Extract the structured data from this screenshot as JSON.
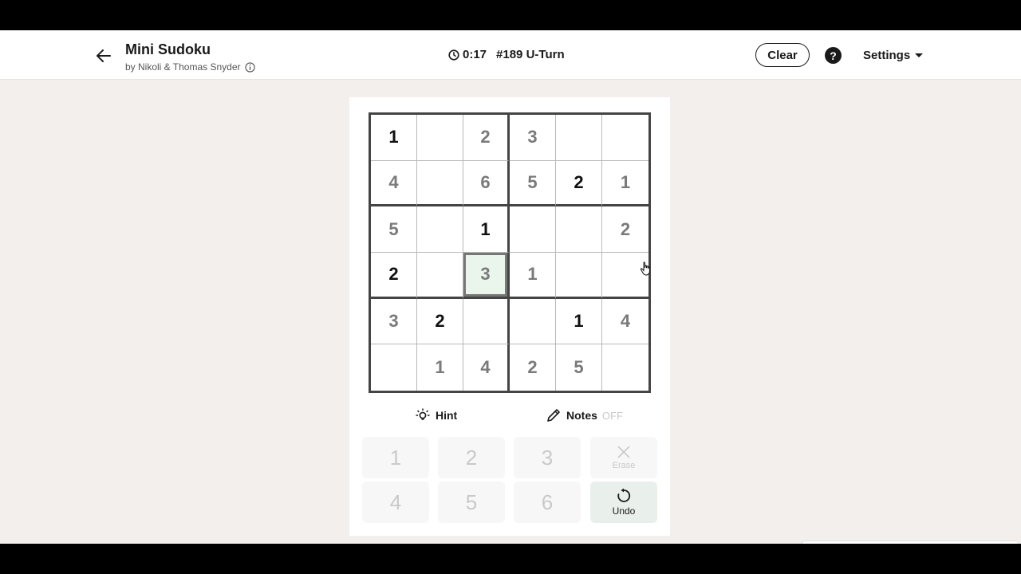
{
  "header": {
    "title": "Mini Sudoku",
    "byline": "by Nikoli & Thomas Snyder",
    "timer": "0:17",
    "puzzle_id": "#189 U-Turn",
    "clear_label": "Clear",
    "help_label": "?",
    "settings_label": "Settings",
    "icons": [
      "back-arrow-icon",
      "info-icon",
      "clock-icon",
      "help-icon",
      "caret-down-icon"
    ]
  },
  "grid": {
    "rows": [
      [
        {
          "v": "1",
          "given": true
        },
        {
          "v": "",
          "given": false
        },
        {
          "v": "2",
          "given": false
        },
        {
          "v": "3",
          "given": false
        },
        {
          "v": "",
          "given": false
        },
        {
          "v": "",
          "given": false
        }
      ],
      [
        {
          "v": "4",
          "given": false
        },
        {
          "v": "",
          "given": false
        },
        {
          "v": "6",
          "given": false
        },
        {
          "v": "5",
          "given": false
        },
        {
          "v": "2",
          "given": true
        },
        {
          "v": "1",
          "given": false
        }
      ],
      [
        {
          "v": "5",
          "given": false
        },
        {
          "v": "",
          "given": false
        },
        {
          "v": "1",
          "given": true
        },
        {
          "v": "",
          "given": false
        },
        {
          "v": "",
          "given": false
        },
        {
          "v": "2",
          "given": false
        }
      ],
      [
        {
          "v": "2",
          "given": true
        },
        {
          "v": "",
          "given": false
        },
        {
          "v": "3",
          "given": false,
          "selected": true
        },
        {
          "v": "1",
          "given": false
        },
        {
          "v": "",
          "given": false
        },
        {
          "v": "",
          "given": false
        }
      ],
      [
        {
          "v": "3",
          "given": false
        },
        {
          "v": "2",
          "given": true
        },
        {
          "v": "",
          "given": false
        },
        {
          "v": "",
          "given": false
        },
        {
          "v": "1",
          "given": true
        },
        {
          "v": "4",
          "given": false
        }
      ],
      [
        {
          "v": "",
          "given": false
        },
        {
          "v": "1",
          "given": false
        },
        {
          "v": "4",
          "given": false
        },
        {
          "v": "2",
          "given": false
        },
        {
          "v": "5",
          "given": false
        },
        {
          "v": "",
          "given": false
        }
      ]
    ]
  },
  "tools": {
    "hint_label": "Hint",
    "notes_label": "Notes",
    "notes_state": "OFF"
  },
  "keypad": {
    "keys": [
      "1",
      "2",
      "3",
      "4",
      "5",
      "6"
    ],
    "erase_label": "Erase",
    "undo_label": "Undo"
  },
  "colors": {
    "given_digit": "#111111",
    "entered_digit": "#7a7a7a",
    "selected_cell_bg": "#eaf6ec",
    "page_bg": "#f3efec",
    "undo_bg": "#e9efeb"
  }
}
